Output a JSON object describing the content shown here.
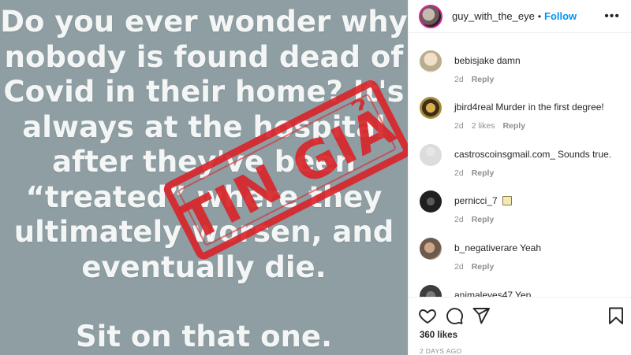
{
  "post": {
    "lines": [
      "Do you ever wonder why",
      "nobody is found dead of",
      "Covid in their home? It's",
      "always at the hospital",
      "after they've been",
      "“treated” where they",
      "ultimately worsen, and",
      "eventually die."
    ],
    "closing": "Sit on that one.",
    "stamp_text": "TIN GIẢ",
    "stamp_color": "#d8262b",
    "background_color": "#8e9ea3"
  },
  "header": {
    "username": "guy_with_the_eye",
    "separator": "•",
    "follow_label": "Follow",
    "more_label": "•••"
  },
  "comments": [
    {
      "user": "bebisjake",
      "text": "damn",
      "time": "2d",
      "likes": "",
      "reply": "Reply"
    },
    {
      "user": "jbird4real",
      "text": "Murder in the first degree!",
      "time": "2d",
      "likes": "2 likes",
      "reply": "Reply"
    },
    {
      "user": "castroscoinsgmail.com_",
      "text": "Sounds true.",
      "time": "2d",
      "likes": "",
      "reply": "Reply"
    },
    {
      "user": "pernicci_7",
      "text": "",
      "time": "2d",
      "likes": "",
      "reply": "Reply"
    },
    {
      "user": "b_negativerare",
      "text": "Yeah",
      "time": "2d",
      "likes": "",
      "reply": "Reply"
    },
    {
      "user": "animaleyes47",
      "text": "Yep",
      "time": "",
      "likes": "",
      "reply": ""
    }
  ],
  "actions": {
    "likes": "360 likes",
    "date": "2 DAYS AGO",
    "icons": [
      "heart-icon",
      "comment-icon",
      "share-icon",
      "bookmark-icon"
    ]
  },
  "colors": {
    "follow": "#0095f6",
    "meta": "#8e8e8e",
    "text": "#262626"
  }
}
